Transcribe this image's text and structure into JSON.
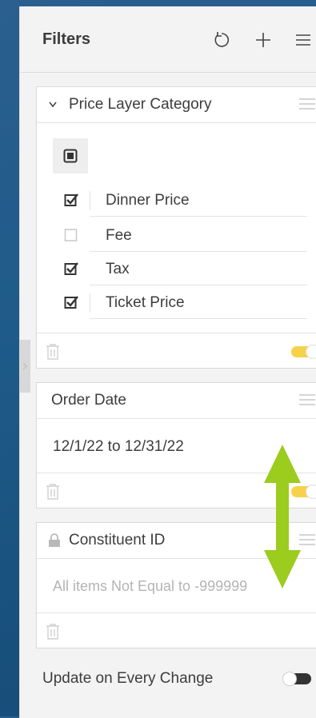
{
  "header": {
    "title": "Filters",
    "icons": [
      "reset-icon",
      "plus-icon",
      "menu-icon"
    ]
  },
  "price_layer": {
    "title": "Price Layer Category",
    "items": [
      {
        "label": "Dinner Price",
        "checked": true
      },
      {
        "label": "Fee",
        "checked": false
      },
      {
        "label": "Tax",
        "checked": true
      },
      {
        "label": "Ticket Price",
        "checked": true
      }
    ],
    "enabled": true
  },
  "order_date": {
    "title": "Order Date",
    "value": "12/1/22 to 12/31/22",
    "enabled": true
  },
  "constituent": {
    "title": "Constituent ID",
    "value": "All items Not Equal to -999999",
    "locked": true
  },
  "footer": {
    "label": "Update on Every Change",
    "enabled": false
  },
  "colors": {
    "accent_toggle": "#f6d24a",
    "annotation_arrow": "#9ccc1d"
  }
}
